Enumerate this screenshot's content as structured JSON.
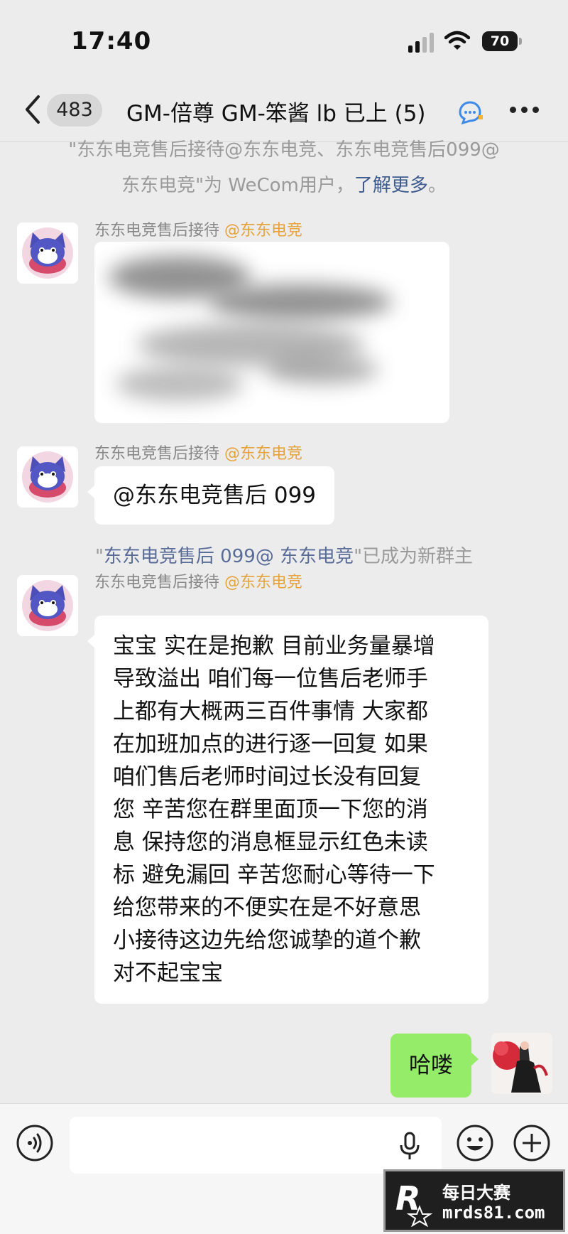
{
  "status_bar": {
    "time": "17:40",
    "battery": "70"
  },
  "header": {
    "back_icon": "chevron-left-icon",
    "unread_count": "483",
    "title": "GM-倍尊 GM-笨酱 lb 已上 (5)",
    "chat_icon": "chat-bubble-icon",
    "more_icon": "more-dots-icon"
  },
  "notice_top": {
    "line1": "\"东东电竞售后接待@东东电竞、东东电竞售后099@",
    "line2_prefix": "东东电竞\"为 WeCom用户，",
    "link": "了解更多",
    "line2_suffix": "。"
  },
  "messages": [
    {
      "sender": "东东电竞售后接待",
      "sender_tag": "@东东电竞",
      "text": "",
      "redacted": true
    },
    {
      "sender": "东东电竞售后接待",
      "sender_tag": "@东东电竞",
      "text": "@东东电竞售后 099"
    },
    {
      "sender": "东东电竞售后接待",
      "sender_tag": "@东东电竞",
      "lines": [
        "宝宝 实在是抱歉 目前业务量暴增",
        "导致溢出 咱们每一位售后老师手",
        "上都有大概两三百件事情 大家都",
        "在加班加点的进行逐一回复 如果",
        "咱们售后老师时间过长没有回复",
        "您 辛苦您在群里面顶一下您的消",
        "息 保持您的消息框显示红色未读",
        "标 避免漏回 辛苦您耐心等待一下",
        "给您带来的不便实在是不好意思",
        "小接待这边先给您诚挚的道个歉",
        "对不起宝宝"
      ]
    },
    {
      "sender": "me",
      "text": "哈喽"
    }
  ],
  "notice_owner": {
    "quote_open": "\"",
    "name": "东东电竞售后 099@ 东东电竞",
    "suffix": "\"已成为新群主"
  },
  "input_bar": {
    "voice_icon": "voice-icon",
    "mic_icon": "microphone-icon",
    "emoji_icon": "emoji-icon",
    "plus_icon": "plus-icon",
    "value": ""
  },
  "watermark": {
    "line1": "每日大赛",
    "line2": "mrds81.com"
  }
}
